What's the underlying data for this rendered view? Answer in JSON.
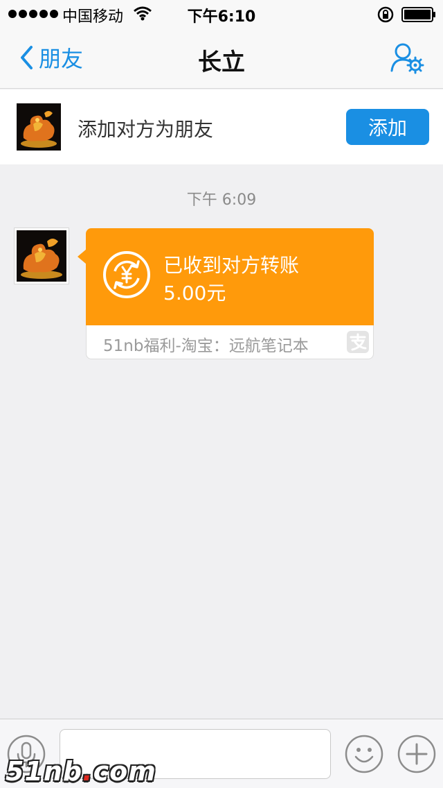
{
  "status_bar": {
    "carrier": "中国移动",
    "time": "下午6:10",
    "icons": [
      "signal-dots-icon",
      "wifi-icon",
      "lock-rotation-icon",
      "battery-icon"
    ]
  },
  "nav": {
    "back_label": "朋友",
    "title": "长立",
    "icons": [
      "chevron-left-icon",
      "profile-settings-icon"
    ],
    "accent_color": "#1a8fe3"
  },
  "add_friend_banner": {
    "text": "添加对方为朋友",
    "button_label": "添加"
  },
  "chat": {
    "timestamp": "下午 6:09",
    "messages": [
      {
        "type": "transfer",
        "title": "已收到对方转账",
        "amount": "5.00元",
        "note": "51nb福利-淘宝：远航笔记本",
        "card_color": "#ff9a0b",
        "icons": [
          "yuan-transfer-icon",
          "alipay-icon"
        ]
      }
    ]
  },
  "input_bar": {
    "icons": [
      "microphone-icon",
      "emoji-icon",
      "plus-icon"
    ],
    "input_value": "",
    "input_placeholder": ""
  },
  "watermark": {
    "text_main": "51nb",
    "text_dot": ".",
    "text_tail": "com"
  }
}
